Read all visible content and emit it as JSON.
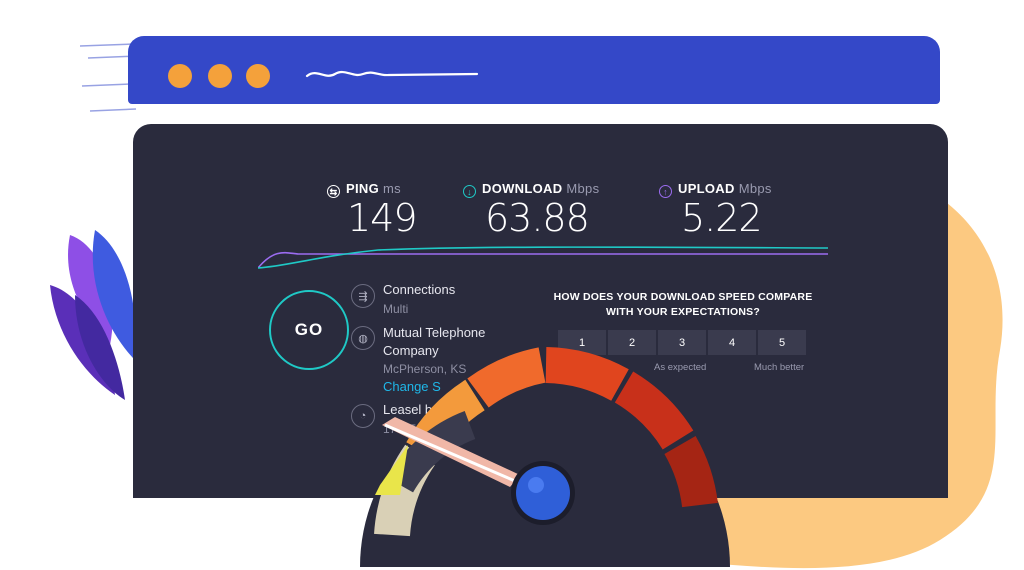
{
  "browser": {
    "window_dots": [
      "window-dot",
      "window-dot",
      "window-dot"
    ],
    "colors": {
      "bar": "#3448c8",
      "dot": "#f4a13b"
    }
  },
  "metrics": {
    "ping": {
      "label": "PING",
      "unit": "ms",
      "value": "149",
      "icon": "ping-icon"
    },
    "download": {
      "label": "DOWNLOAD",
      "unit": "Mbps",
      "value": "63.88",
      "icon": "download-arrow-icon"
    },
    "upload": {
      "label": "UPLOAD",
      "unit": "Mbps",
      "value": "5.22",
      "icon": "upload-arrow-icon"
    }
  },
  "go_button": {
    "label": "GO"
  },
  "connections": {
    "title": "Connections",
    "value": "Multi",
    "icon": "connections-icon"
  },
  "isp": {
    "title_line1": "Mutual Telephone",
    "title_line2": "Company",
    "location": "McPherson, KS",
    "change_link": "Change S",
    "icon": "globe-icon"
  },
  "host": {
    "title": "Leasel b",
    "ip": "17 .25.170",
    "icon": "user-icon"
  },
  "survey": {
    "question_line1": "HOW DOES YOUR DOWNLOAD SPEED COMPARE",
    "question_line2": "WITH YOUR EXPECTATIONS?",
    "ratings": [
      "1",
      "2",
      "3",
      "4",
      "5"
    ],
    "caption_mid": "As expected",
    "caption_end": "Much better"
  },
  "colors": {
    "panel": "#2a2b3d",
    "accent_teal": "#1fc9c6",
    "accent_purple": "#9b6cf0",
    "link": "#1fb7e8",
    "blob": "#fcc981"
  }
}
